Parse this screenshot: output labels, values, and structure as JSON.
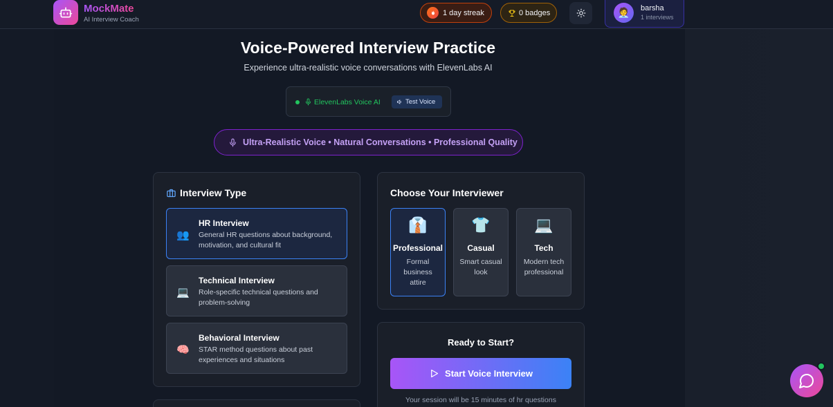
{
  "header": {
    "brand_name": "MockMate",
    "brand_sub": "AI Interview Coach",
    "streak_label": "1 day streak",
    "badges_label": "0 badges",
    "user": {
      "name": "barsha",
      "sub": "1 interviews"
    }
  },
  "hero": {
    "title": "Voice-Powered Interview Practice",
    "subtitle": "Experience ultra-realistic voice conversations with ElevenLabs AI",
    "voice_status": "ElevenLabs Voice AI",
    "test_voice": "Test Voice",
    "pill": "Ultra-Realistic Voice • Natural Conversations • Professional Quality"
  },
  "interview_type": {
    "title": "Interview Type",
    "items": [
      {
        "title": "HR Interview",
        "desc": "General HR questions about background, motivation, and cultural fit",
        "icon": "people-icon",
        "selected": true
      },
      {
        "title": "Technical Interview",
        "desc": "Role-specific technical questions and problem-solving",
        "icon": "laptop-icon",
        "selected": false
      },
      {
        "title": "Behavioral Interview",
        "desc": "STAR method questions about past experiences and situations",
        "icon": "brain-icon",
        "selected": false
      }
    ]
  },
  "interviewer": {
    "title": "Choose Your Interviewer",
    "items": [
      {
        "name": "Professional",
        "desc": "Formal business attire",
        "icon": "suit-icon",
        "selected": true
      },
      {
        "name": "Casual",
        "desc": "Smart casual look",
        "icon": "tshirt-icon",
        "selected": false
      },
      {
        "name": "Tech",
        "desc": "Modern tech professional",
        "icon": "laptop-icon",
        "selected": false
      }
    ]
  },
  "start": {
    "title": "Ready to Start?",
    "button": "Start Voice Interview",
    "note": "Your session will be 15 minutes of hr questions"
  },
  "colors": {
    "accent_purple": "#a855f7",
    "accent_pink": "#ec4899",
    "accent_blue": "#3b82f6",
    "status_green": "#22c55e"
  }
}
